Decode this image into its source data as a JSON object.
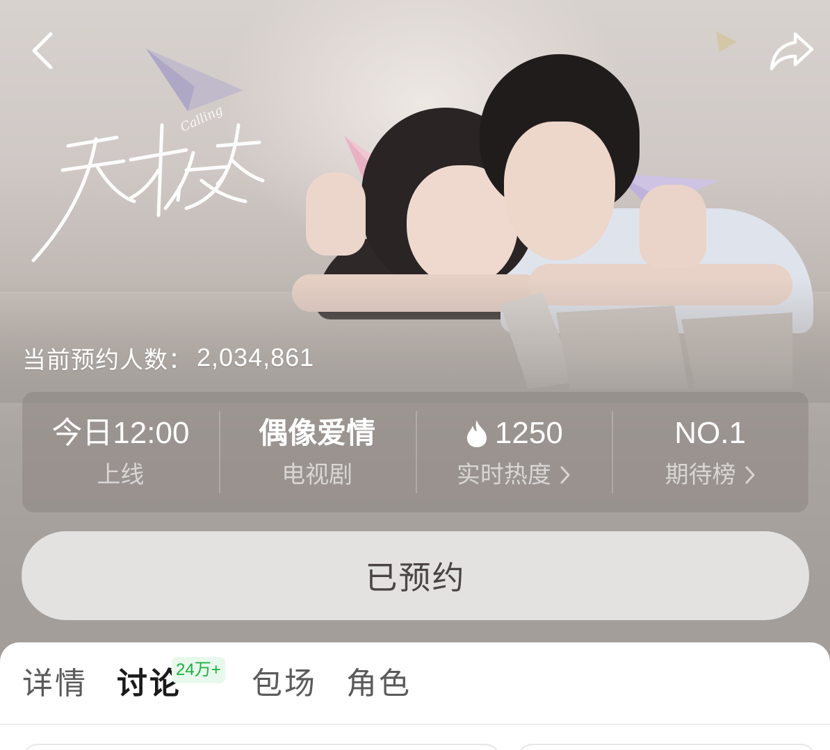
{
  "show": {
    "title_art": "天才女友",
    "title_art_sub": "Calling"
  },
  "booking": {
    "label": "当前预约人数：",
    "count": "2,034,861"
  },
  "stats": [
    {
      "value": "今日12:00",
      "label": "上线",
      "icon": "",
      "chevron": false
    },
    {
      "value": "偶像爱情",
      "label": "电视剧",
      "icon": "",
      "chevron": false
    },
    {
      "value": "1250",
      "label": "实时热度",
      "icon": "flame-icon",
      "chevron": true
    },
    {
      "value": "NO.1",
      "label": "期待榜",
      "icon": "",
      "chevron": true
    }
  ],
  "reserve_button": {
    "label": "已预约",
    "state": "reserved"
  },
  "tabs": [
    {
      "label": "详情",
      "active": false
    },
    {
      "label": "讨论",
      "active": true,
      "badge": "24万+"
    },
    {
      "label": "包场",
      "active": false
    },
    {
      "label": "角色",
      "active": false
    }
  ],
  "icons": {
    "back": "chevron-left-icon",
    "share": "share-arrow-icon"
  },
  "colors": {
    "badge_text": "#19b13f",
    "badge_bg": "#e9f8ec",
    "button_bg": "#e4e2e1",
    "button_text": "#4a4544"
  }
}
